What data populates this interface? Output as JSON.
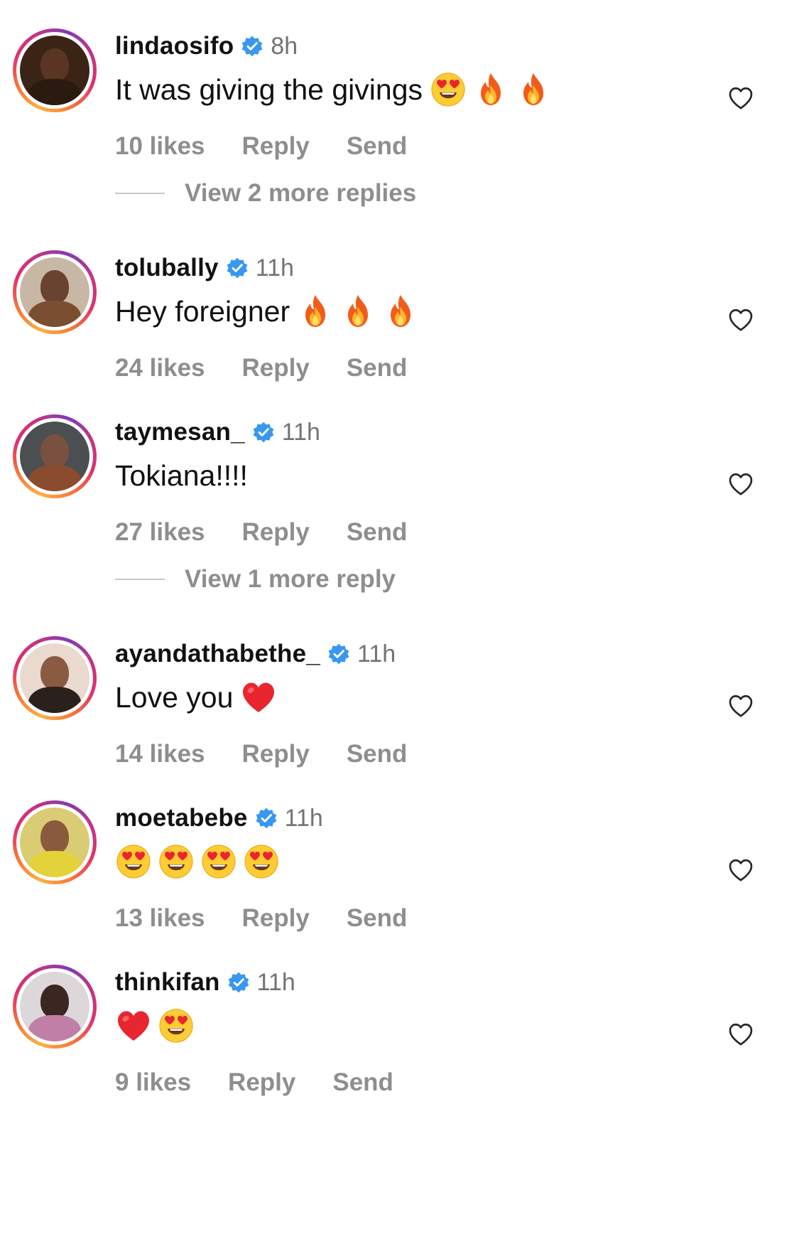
{
  "comments": [
    {
      "username": "lindaosifo",
      "time": "8h",
      "text": "It was giving the givings",
      "emojis": [
        "heart-eyes",
        "fire",
        "fire"
      ],
      "likes": "10 likes",
      "reply": "Reply",
      "send": "Send",
      "avatar": {
        "bg": "#3b2416",
        "face": "#5a3524",
        "body": "#2a1a10"
      }
    },
    {
      "username": "tolubally",
      "time": "11h",
      "text": "Hey foreigner",
      "emojis": [
        "fire",
        "fire",
        "fire"
      ],
      "likes": "24 likes",
      "reply": "Reply",
      "send": "Send",
      "avatar": {
        "bg": "#c9b7a6",
        "face": "#6a4330",
        "body": "#7a4e31"
      }
    },
    {
      "username": "taymesan_",
      "time": "11h",
      "text": "Tokiana!!!!",
      "emojis": [],
      "likes": "27 likes",
      "reply": "Reply",
      "send": "Send",
      "avatar": {
        "bg": "#4b4f52",
        "face": "#7a5040",
        "body": "#8a4b2e"
      }
    },
    {
      "username": "ayandathabethe_",
      "time": "11h",
      "text": "Love you",
      "emojis": [
        "red-heart"
      ],
      "likes": "14 likes",
      "reply": "Reply",
      "send": "Send",
      "avatar": {
        "bg": "#e9d9cf",
        "face": "#8a5a42",
        "body": "#2b211c"
      }
    },
    {
      "username": "moetabebe",
      "time": "11h",
      "text": "",
      "emojis": [
        "heart-eyes",
        "heart-eyes",
        "heart-eyes",
        "heart-eyes"
      ],
      "likes": "13 likes",
      "reply": "Reply",
      "send": "Send",
      "avatar": {
        "bg": "#d9cc74",
        "face": "#8a5a3c",
        "body": "#e4d23a"
      }
    },
    {
      "username": "thinkifan",
      "time": "11h",
      "text": "",
      "emojis": [
        "red-heart",
        "heart-eyes"
      ],
      "likes": "9 likes",
      "reply": "Reply",
      "send": "Send",
      "avatar": {
        "bg": "#dcd8da",
        "face": "#3a2722",
        "body": "#c07fa6"
      }
    }
  ],
  "view_replies": [
    {
      "label": "View 2 more replies"
    },
    {
      "label": "View 1 more reply"
    }
  ],
  "colors": {
    "verified": "#3897f0",
    "muted": "#8e8e8e",
    "ring": [
      "#fcaf45",
      "#e1306c",
      "#833ab4"
    ]
  },
  "icons": {
    "heart_outline": "heart-outline-icon",
    "verified": "verified-badge-icon"
  }
}
